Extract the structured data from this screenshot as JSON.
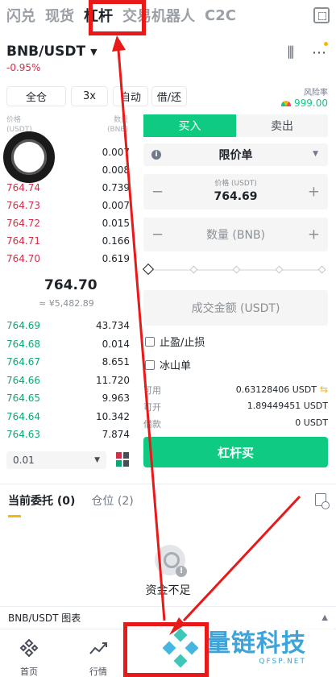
{
  "top_tabs": [
    "闪兑",
    "现货",
    "杠杆",
    "交易机器人",
    "C2C"
  ],
  "pair": {
    "name": "BNB/USDT",
    "change": "-0.95%"
  },
  "margin_controls": {
    "mode": "全仓",
    "leverage": "3x",
    "auto": "自动",
    "borrow": "借/还"
  },
  "risk": {
    "label": "风险率",
    "value": "999.00"
  },
  "orderbook": {
    "price_header": "价格\n(USDT)",
    "qty_header": "数量\n(BNB)",
    "asks": [
      {
        "price": "",
        "qty": "0.007"
      },
      {
        "price": "",
        "qty": "0.008"
      },
      {
        "price": "764.74",
        "qty": "0.739"
      },
      {
        "price": "764.73",
        "qty": "0.007"
      },
      {
        "price": "764.72",
        "qty": "0.015"
      },
      {
        "price": "764.71",
        "qty": "0.166"
      },
      {
        "price": "764.70",
        "qty": "0.619"
      }
    ],
    "last_price": "764.70",
    "last_fiat": "≈ ¥5,482.89",
    "bids": [
      {
        "price": "764.69",
        "qty": "43.734"
      },
      {
        "price": "764.68",
        "qty": "0.014"
      },
      {
        "price": "764.67",
        "qty": "8.651"
      },
      {
        "price": "764.66",
        "qty": "11.720"
      },
      {
        "price": "764.65",
        "qty": "9.963"
      },
      {
        "price": "764.64",
        "qty": "10.342"
      },
      {
        "price": "764.63",
        "qty": "7.874"
      }
    ],
    "depth": "0.01"
  },
  "form": {
    "buy_tab": "买入",
    "sell_tab": "卖出",
    "order_type": "限价单",
    "price_label": "价格 (USDT)",
    "price_value": "764.69",
    "qty_placeholder": "数量 (BNB)",
    "total_placeholder": "成交金额 (USDT)",
    "tp_sl": "止盈/止损",
    "iceberg": "冰山单",
    "available_label": "可用",
    "available_value": "0.63128406 USDT",
    "max_open_label": "可开",
    "max_open_value": "1.89449451 USDT",
    "borrowed_label": "借款",
    "borrowed_value": "0 USDT",
    "action": "杠杆买"
  },
  "bottom_tabs": {
    "open_orders": "当前委托 (0)",
    "positions": "仓位 (2)"
  },
  "empty_text": "资金不足",
  "chart_bar": "BNB/USDT 图表",
  "nav": {
    "home": "首页",
    "markets": "行情"
  },
  "watermark": {
    "title": "量链科技",
    "sub": "QFSP.NET"
  }
}
